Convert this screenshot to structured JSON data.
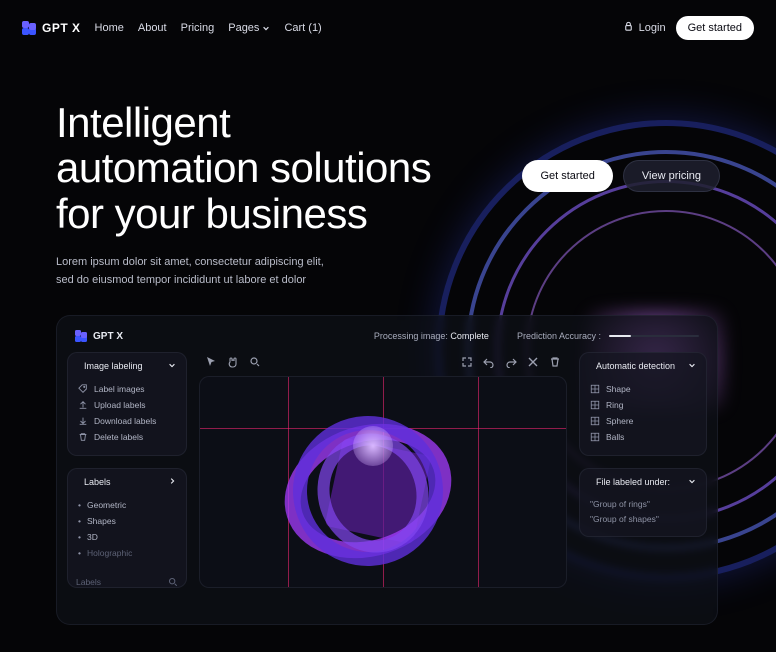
{
  "nav": {
    "brand": "GPT X",
    "links": {
      "home": "Home",
      "about": "About",
      "pricing": "Pricing",
      "pages": "Pages",
      "cart": "Cart (1)"
    },
    "login": "Login",
    "get_started": "Get started"
  },
  "hero": {
    "headline_l1": "Intelligent",
    "headline_l2": "automation solutions",
    "headline_l3": "for your business",
    "sub_l1": "Lorem ipsum dolor sit amet, consectetur adipiscing elit,",
    "sub_l2": "sed do eiusmod tempor incididunt ut labore et dolor",
    "cta_primary": "Get started",
    "cta_secondary": "View pricing"
  },
  "dashboard": {
    "brand": "GPT X",
    "status_label": "Processing image:",
    "status_value": "Complete",
    "accuracy_label": "Prediction Accuracy :",
    "image_labeling": {
      "title": "Image labeling",
      "items": {
        "label_images": "Label images",
        "upload_labels": "Upload labels",
        "download_labels": "Download labels",
        "delete_labels": "Delete labels"
      }
    },
    "labels_panel": {
      "title": "Labels",
      "items": {
        "geometric": "Geometric",
        "shapes": "Shapes",
        "three_d": "3D",
        "holographic": "Holographic"
      },
      "search_placeholder": "Labels"
    },
    "auto_detect": {
      "title": "Automatic detection",
      "items": {
        "shape": "Shape",
        "ring": "Ring",
        "sphere": "Sphere",
        "balls": "Balls"
      }
    },
    "labeled_under": {
      "title": "File labeled under:",
      "g1": "\"Group of rings\"",
      "g2": "\"Group of shapes\""
    }
  }
}
